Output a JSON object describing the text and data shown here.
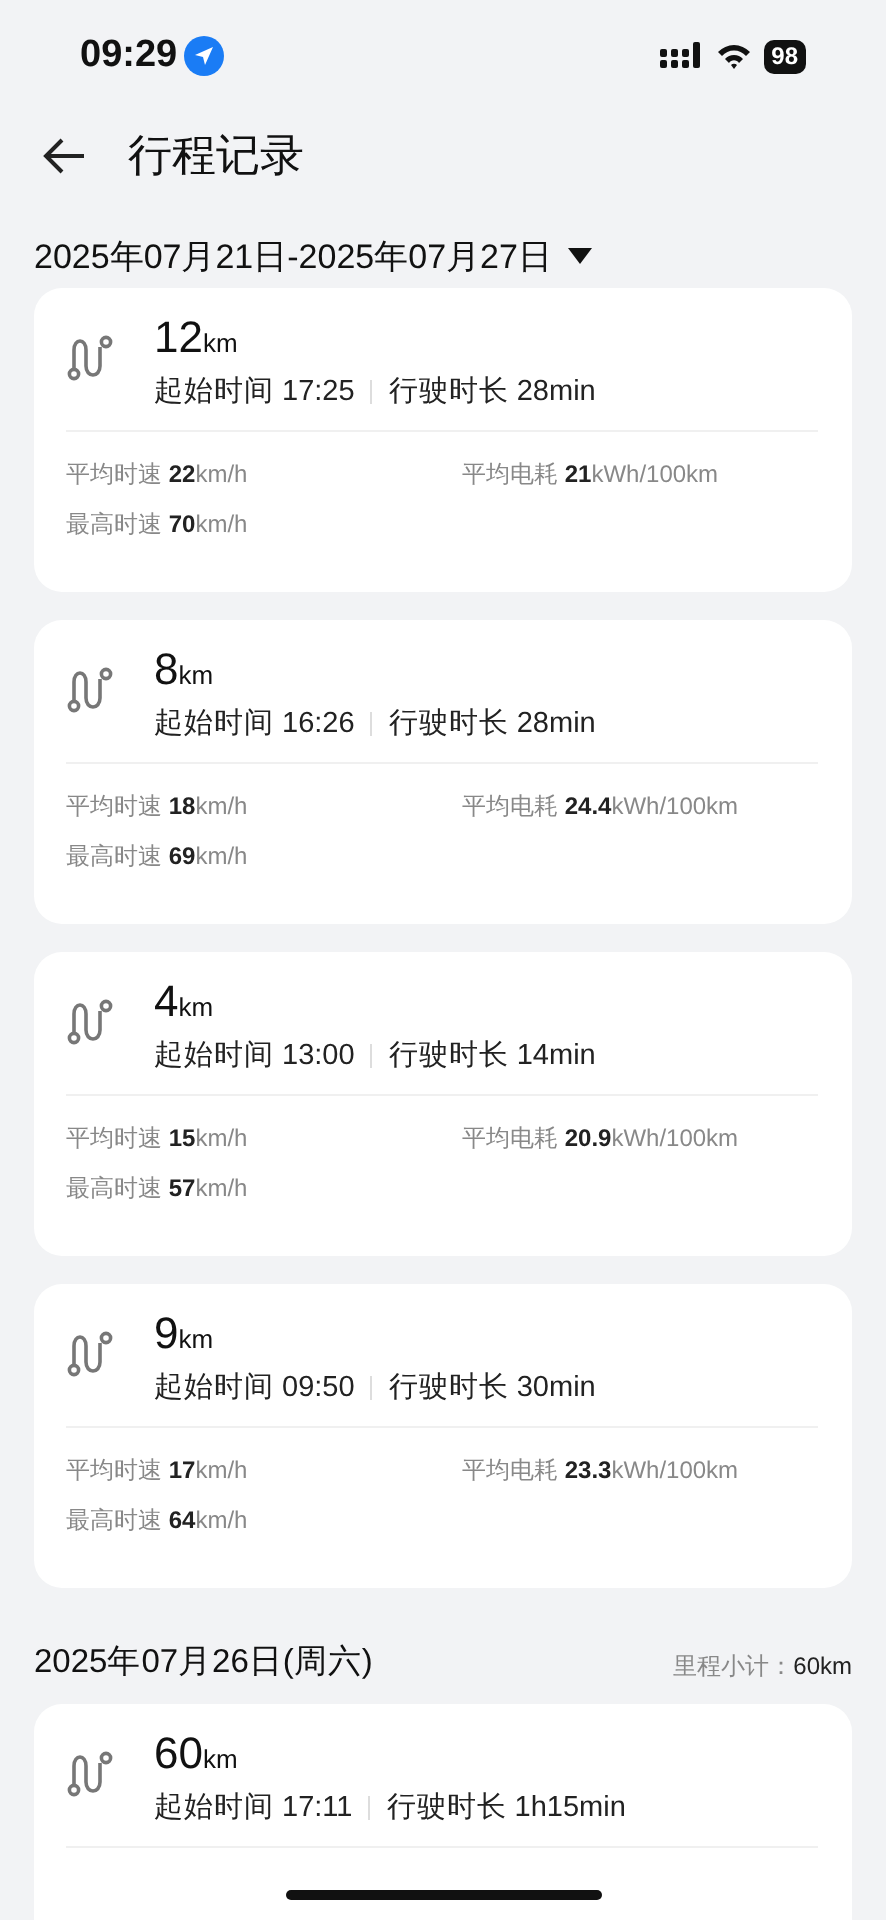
{
  "status_bar": {
    "time": "09:29",
    "battery": "98"
  },
  "header": {
    "title": "行程记录"
  },
  "range": {
    "label": "2025年07月21日-2025年07月27日"
  },
  "trips": [
    {
      "distance": "12",
      "unit": "km",
      "start_label": "起始时间 17:25",
      "duration_label": "行驶时长 28min",
      "avg_speed": "平均时速 **22**km/h",
      "avg_energy": "平均电耗 **21**kWh/100km",
      "max_speed": "最高时速 **70**km/h"
    },
    {
      "distance": "8",
      "unit": "km",
      "start_label": "起始时间 16:26",
      "duration_label": "行驶时长 28min",
      "avg_speed": "平均时速 **18**km/h",
      "avg_energy": "平均电耗 **24.4**kWh/100km",
      "max_speed": "最高时速 **69**km/h"
    },
    {
      "distance": "4",
      "unit": "km",
      "start_label": "起始时间 13:00",
      "duration_label": "行驶时长 14min",
      "avg_speed": "平均时速 **15**km/h",
      "avg_energy": "平均电耗 **20.9**kWh/100km",
      "max_speed": "最高时速 **57**km/h"
    },
    {
      "distance": "9",
      "unit": "km",
      "start_label": "起始时间 09:50",
      "duration_label": "行驶时长 30min",
      "avg_speed": "平均时速 **17**km/h",
      "avg_energy": "平均电耗 **23.3**kWh/100km",
      "max_speed": "最高时速 **64**km/h"
    }
  ],
  "day": {
    "date": "2025年07月26日(周六)",
    "subtotal_label": "里程小计：",
    "subtotal_value": "60km",
    "trips": [
      {
        "distance": "60",
        "unit": "km",
        "start_label": "起始时间 17:11",
        "duration_label": "行驶时长 1h15min"
      }
    ]
  }
}
